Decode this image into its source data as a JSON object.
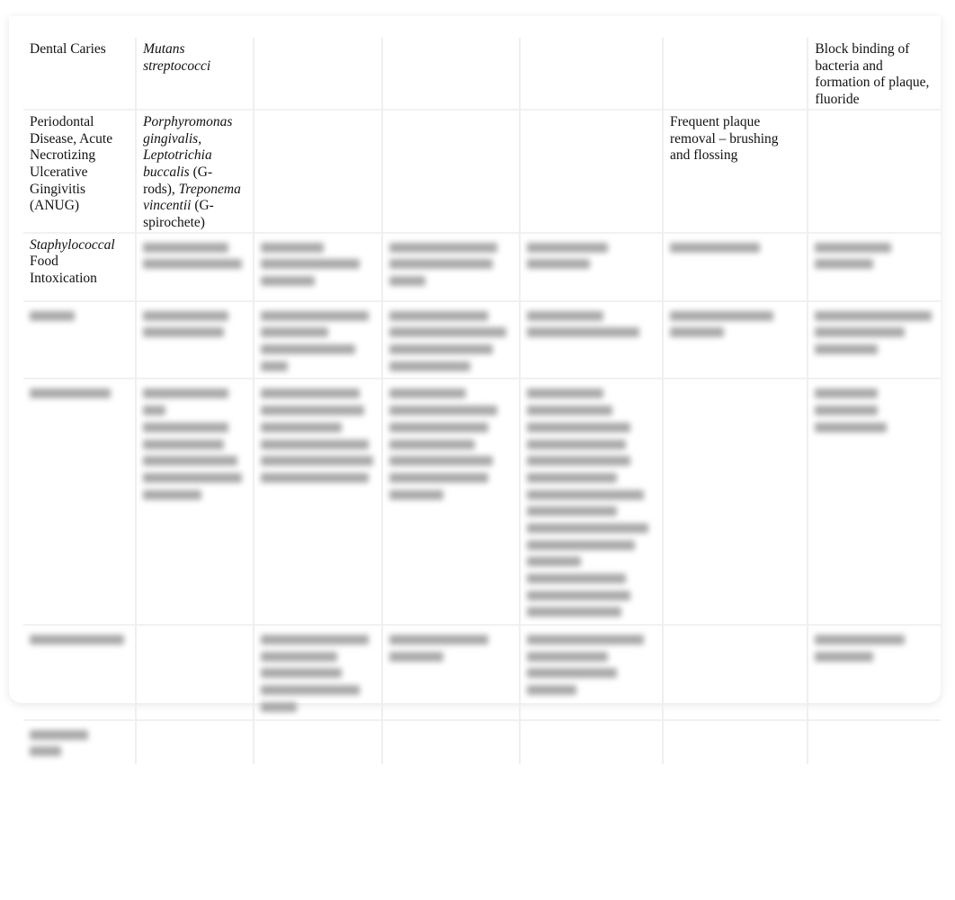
{
  "document": {
    "type": "table",
    "columns": 7,
    "rows": [
      {
        "disease": "Dental Caries",
        "organism_parts": [
          {
            "text": "Mutans streptococci",
            "italic": true
          }
        ],
        "prevention": "",
        "treatment_col7": "Block binding of bacteria and formation of plaque, fluoride",
        "blurred": false
      },
      {
        "disease": "Periodontal Disease, Acute Necrotizing Ulcerative Gingivitis (ANUG)",
        "organism_parts": [
          {
            "text": "Porphyromonas gingivalis",
            "italic": true
          },
          {
            "text": ", ",
            "italic": false
          },
          {
            "text": "Leptotrichia buccalis",
            "italic": true
          },
          {
            "text": " (G- rods), ",
            "italic": false
          },
          {
            "text": "Treponema vincentii",
            "italic": true
          },
          {
            "text": " (G- spirochete)",
            "italic": false
          }
        ],
        "prevention": "Frequent plaque removal – brushing and flossing",
        "treatment_col7": "",
        "blurred": false
      },
      {
        "disease_parts": [
          {
            "text": "Staphylococcal",
            "italic": true
          },
          {
            "text": " Food Intoxication",
            "italic": false
          }
        ],
        "blurred": true
      },
      {
        "blurred": true
      },
      {
        "blurred": true
      },
      {
        "blurred": true
      },
      {
        "blurred": true
      }
    ],
    "blurred_note": "Remaining cell content is obscured (blurred preview)"
  }
}
